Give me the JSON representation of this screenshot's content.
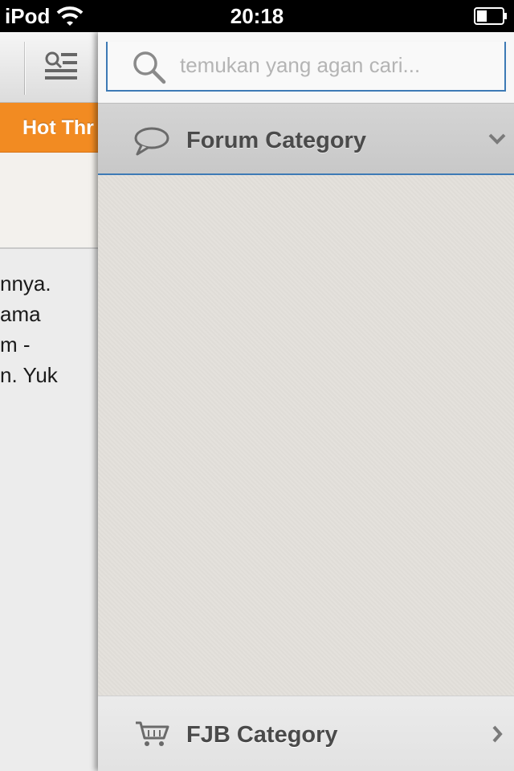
{
  "status_bar": {
    "carrier": "iPod",
    "time": "20:18",
    "icons": [
      "wifi-icon",
      "battery-icon"
    ]
  },
  "main_view": {
    "header_icon": "filter-menu-icon",
    "tab_label": "Hot Thr",
    "paragraph_lines": [
      "nnya.",
      "ama",
      "m -",
      "n. Yuk"
    ]
  },
  "side_panel": {
    "search": {
      "placeholder": "temukan yang agan cari...",
      "icon": "search-icon"
    },
    "forum_category": {
      "label": "Forum Category",
      "icon": "speech-bubble-icon",
      "indicator": "chevron-down-icon"
    },
    "fjb_category": {
      "label": "FJB Category",
      "icon": "cart-icon",
      "indicator": "chevron-right-icon"
    }
  },
  "colors": {
    "accent_orange": "#f28b22",
    "accent_blue": "#3d7ab5",
    "panel_bg": "#e3e0db",
    "label_text": "#4a4a4a"
  }
}
